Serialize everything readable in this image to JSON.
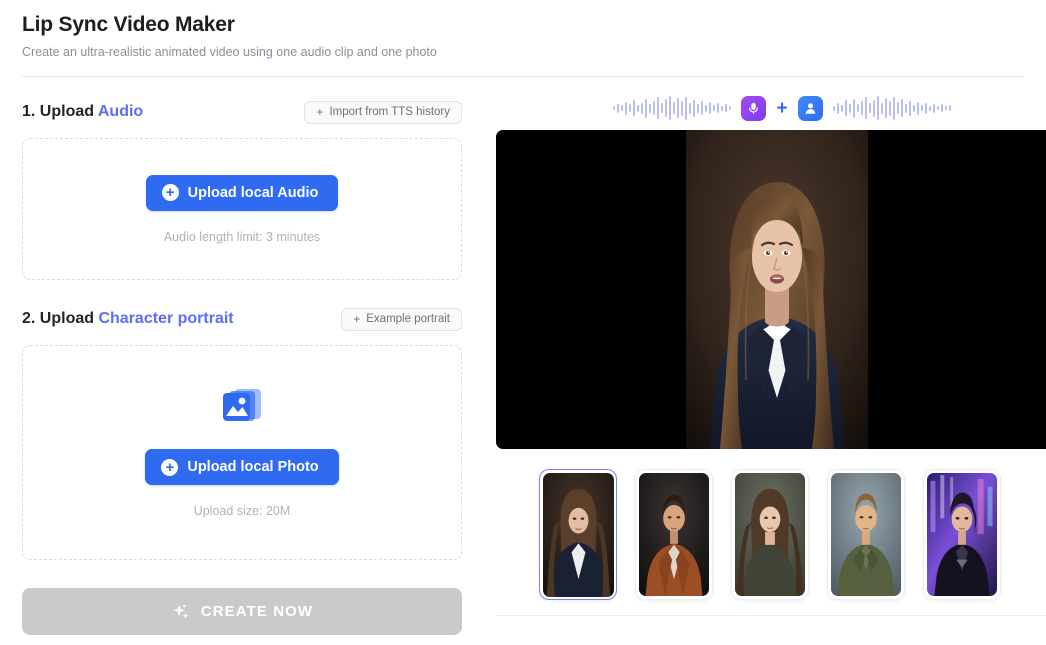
{
  "header": {
    "title": "Lip Sync Video Maker",
    "subtitle": "Create an ultra-realistic animated video using one audio clip and one photo"
  },
  "colors": {
    "accent_blue": "#2f6bf0",
    "accent_purple": "#5b6ef5",
    "mic_badge": "#8b3df2",
    "person_badge": "#2f6bf0",
    "waveform": "#b9bff0",
    "create_disabled": "#cacaca",
    "selected_thumb_border": "#7b84e8"
  },
  "steps": {
    "audio": {
      "number": "1.",
      "label_prefix": "Upload",
      "label_accent": "Audio",
      "action_button": {
        "label": "Import from TTS history",
        "icon": "plus-icon",
        "prefix": "+"
      },
      "upload_button": {
        "label": "Upload local Audio",
        "icon": "circle-plus-icon"
      },
      "hint": "Audio length limit: 3 minutes"
    },
    "portrait": {
      "number": "2.",
      "label_prefix": "Upload",
      "label_accent": "Character portrait",
      "action_button": {
        "label": "Example portrait",
        "icon": "plus-icon",
        "prefix": "+"
      },
      "upload_button": {
        "label": "Upload local Photo",
        "icon": "circle-plus-icon"
      },
      "hint": "Upload size: 20M",
      "dropzone_icon": "image-stack-icon"
    }
  },
  "create": {
    "label": "CREATE NOW",
    "icon": "sparkle-icon",
    "enabled": false
  },
  "preview": {
    "left_waveform_icon": "audio-waveform-icon",
    "mic_icon": "microphone-icon",
    "plus_glyph": "+",
    "person_icon": "person-icon",
    "right_waveform_icon": "audio-waveform-icon",
    "left_wave_bars": [
      4,
      9,
      6,
      13,
      8,
      16,
      7,
      11,
      19,
      9,
      14,
      22,
      10,
      18,
      24,
      12,
      20,
      15,
      23,
      11,
      17,
      9,
      14,
      7,
      12,
      6,
      10,
      5,
      8,
      4
    ],
    "right_wave_bars": [
      5,
      11,
      7,
      16,
      9,
      19,
      8,
      14,
      22,
      10,
      17,
      24,
      11,
      20,
      15,
      23,
      12,
      18,
      9,
      15,
      7,
      13,
      6,
      11,
      5,
      9,
      4,
      8,
      4,
      6
    ],
    "current_portrait": {
      "name": "woman-navy-suit-portrait",
      "description": "Woman with long brown hair in navy suit and white shirt on dark brown background"
    }
  },
  "thumbnails": [
    {
      "name": "thumb-woman-navy-suit",
      "selected": true,
      "label": "Woman in navy suit"
    },
    {
      "name": "thumb-man-rust-coat",
      "selected": false,
      "label": "Man in rust coat"
    },
    {
      "name": "thumb-woman-olive-top",
      "selected": false,
      "label": "Woman in olive turtleneck"
    },
    {
      "name": "thumb-man-olive-shirt",
      "selected": false,
      "label": "Man in olive shirt"
    },
    {
      "name": "thumb-cyberpunk-woman",
      "selected": false,
      "label": "Cyberpunk woman"
    }
  ]
}
